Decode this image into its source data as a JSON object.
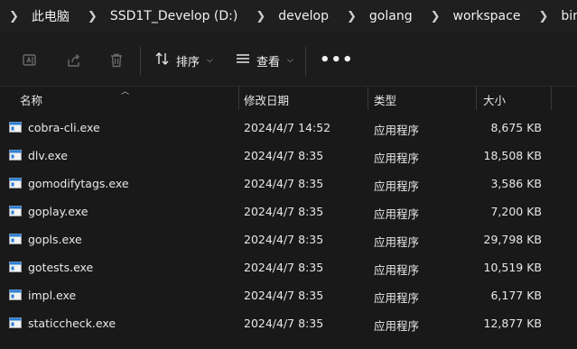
{
  "breadcrumb": [
    {
      "label": "此电脑"
    },
    {
      "label": "SSD1T_Develop (D:)"
    },
    {
      "label": "develop"
    },
    {
      "label": "golang"
    },
    {
      "label": "workspace"
    },
    {
      "label": "bin"
    }
  ],
  "toolbar": {
    "sort_label": "排序",
    "view_label": "查看",
    "more_label": "•••",
    "icons": [
      "rename-icon",
      "share-icon",
      "delete-icon",
      "sort-icon",
      "view-icon",
      "more-icon"
    ]
  },
  "columns": {
    "name": "名称",
    "modified": "修改日期",
    "type": "类型",
    "size": "大小"
  },
  "files": [
    {
      "name": "cobra-cli.exe",
      "modified": "2024/4/7 14:52",
      "type": "应用程序",
      "size": "8,675 KB"
    },
    {
      "name": "dlv.exe",
      "modified": "2024/4/7 8:35",
      "type": "应用程序",
      "size": "18,508 KB"
    },
    {
      "name": "gomodifytags.exe",
      "modified": "2024/4/7 8:35",
      "type": "应用程序",
      "size": "3,586 KB"
    },
    {
      "name": "goplay.exe",
      "modified": "2024/4/7 8:35",
      "type": "应用程序",
      "size": "7,200 KB"
    },
    {
      "name": "gopls.exe",
      "modified": "2024/4/7 8:35",
      "type": "应用程序",
      "size": "29,798 KB"
    },
    {
      "name": "gotests.exe",
      "modified": "2024/4/7 8:35",
      "type": "应用程序",
      "size": "10,519 KB"
    },
    {
      "name": "impl.exe",
      "modified": "2024/4/7 8:35",
      "type": "应用程序",
      "size": "6,177 KB"
    },
    {
      "name": "staticcheck.exe",
      "modified": "2024/4/7 8:35",
      "type": "应用程序",
      "size": "12,877 KB"
    }
  ],
  "colors": {
    "background": "#191919",
    "text": "#e6e6e6",
    "icon_blue": "#2b7fd6"
  }
}
